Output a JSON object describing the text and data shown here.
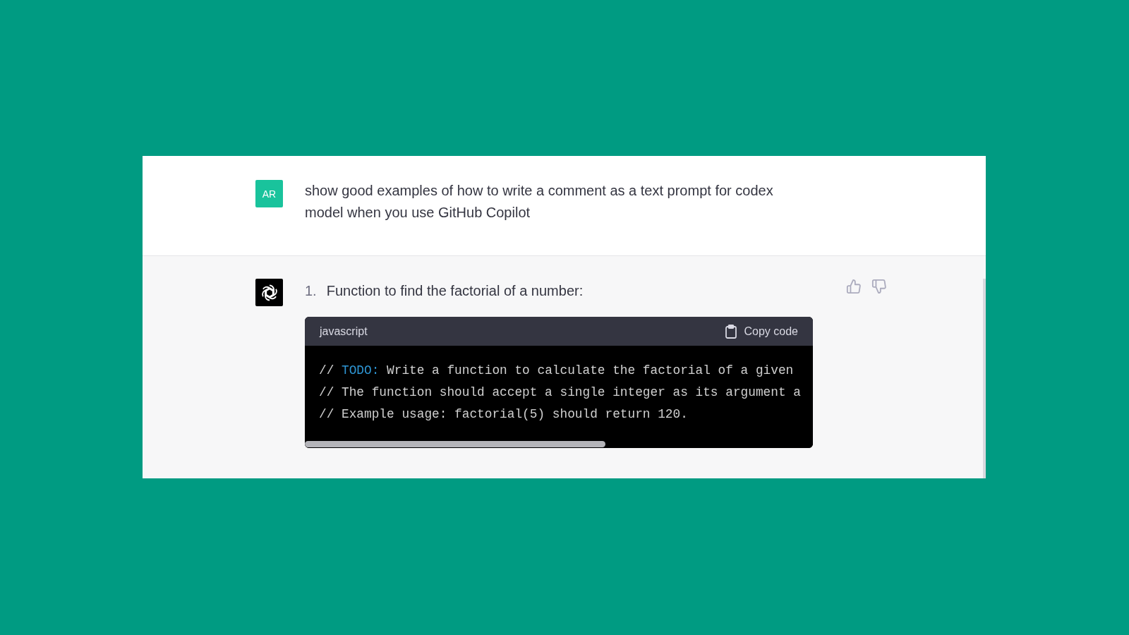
{
  "user_message": {
    "avatar": "AR",
    "text": "show good examples of how to write a comment as a text prompt for codex model when you use GitHub Copilot"
  },
  "assistant_message": {
    "list_number": "1.",
    "text": "Function to find the factorial of a number:",
    "code_block": {
      "language": "javascript",
      "copy_label": "Copy code",
      "lines": [
        [
          {
            "kind": "comment",
            "text": "// "
          },
          {
            "kind": "keyword",
            "text": "TODO:"
          },
          {
            "kind": "comment",
            "text": " Write a function to calculate the factorial of a given"
          }
        ],
        [
          {
            "kind": "comment",
            "text": "// The function should accept a single integer as its argument a"
          }
        ],
        [
          {
            "kind": "comment",
            "text": "// Example usage: factorial(5) should return 120."
          }
        ]
      ]
    }
  }
}
